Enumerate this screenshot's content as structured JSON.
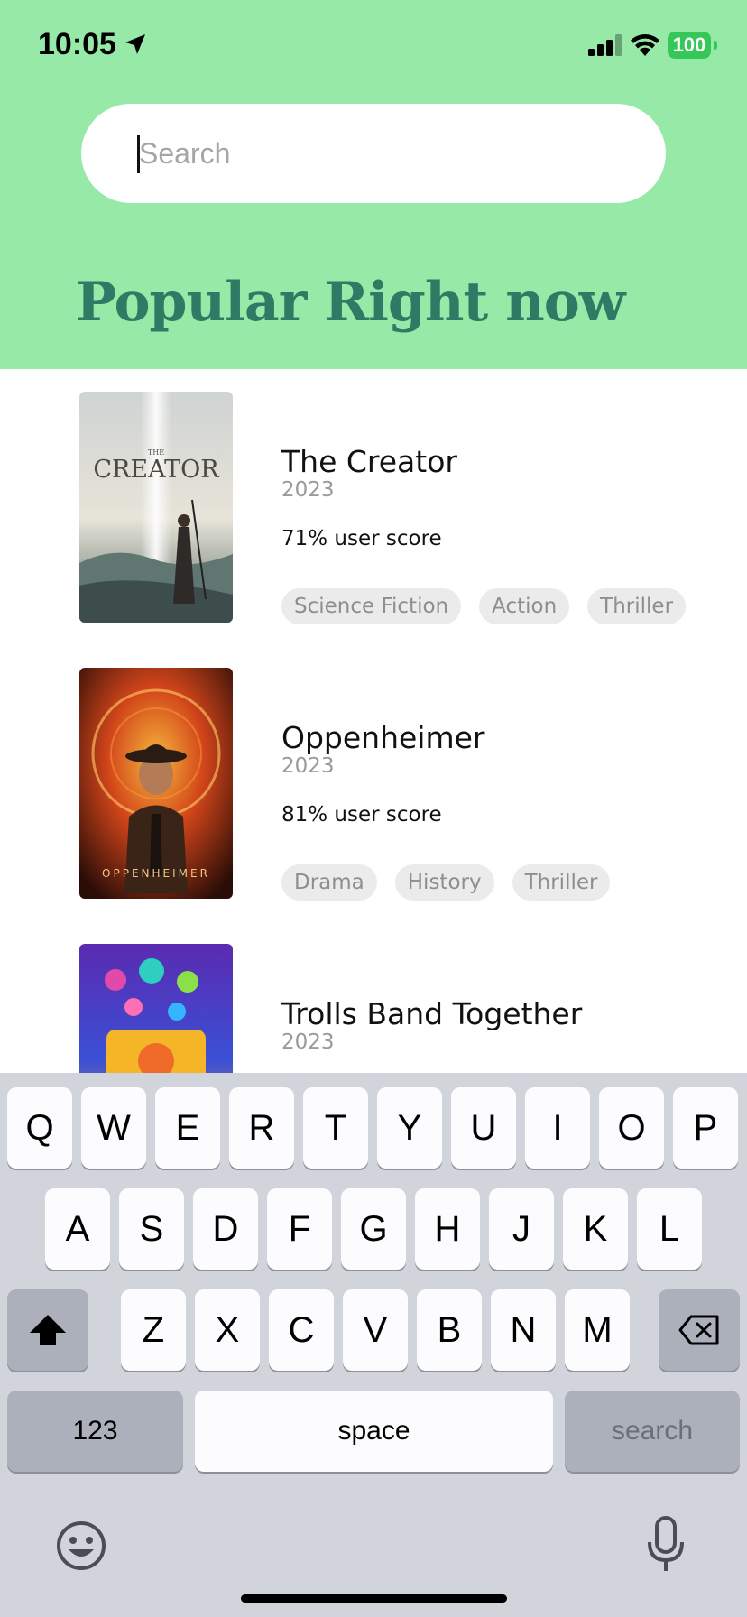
{
  "status": {
    "time": "10:05",
    "battery": "100"
  },
  "search": {
    "placeholder": "Search",
    "value": ""
  },
  "section_title": "Popular Right now",
  "movies": [
    {
      "title": "The Creator",
      "year": "2023",
      "score": "71% user score",
      "genres": [
        "Science Fiction",
        "Action",
        "Thriller"
      ],
      "poster_text": "THE CREATOR"
    },
    {
      "title": "Oppenheimer",
      "year": "2023",
      "score": "81% user score",
      "genres": [
        "Drama",
        "History",
        "Thriller"
      ],
      "poster_text": "OPPENHEIMER"
    },
    {
      "title": "Trolls Band Together",
      "year": "2023"
    }
  ],
  "keyboard": {
    "row1": [
      "Q",
      "W",
      "E",
      "R",
      "T",
      "Y",
      "U",
      "I",
      "O",
      "P"
    ],
    "row2": [
      "A",
      "S",
      "D",
      "F",
      "G",
      "H",
      "J",
      "K",
      "L"
    ],
    "row3": [
      "Z",
      "X",
      "C",
      "V",
      "B",
      "N",
      "M"
    ],
    "numbers_label": "123",
    "space_label": "space",
    "search_label": "search"
  },
  "colors": {
    "header_bg": "#97e9a8",
    "title": "#2f7a64",
    "battery": "#36c759"
  }
}
